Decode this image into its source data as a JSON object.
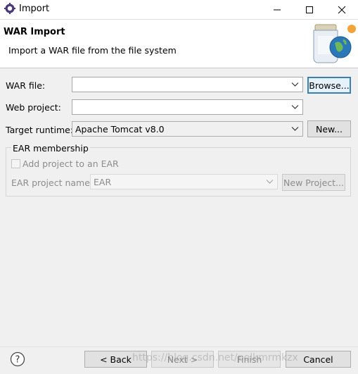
{
  "window": {
    "title": "Import",
    "icon": "eclipse-gear-icon",
    "controls": [
      "minimize",
      "maximize",
      "close"
    ]
  },
  "banner": {
    "title": "WAR Import",
    "description": "Import a WAR file from the file system",
    "image": "war-jar-globe-icon"
  },
  "form": {
    "war_file": {
      "label": "WAR file:",
      "value": "",
      "browse_label": "Browse..."
    },
    "web_project": {
      "label": "Web project:",
      "value": ""
    },
    "target_runtime": {
      "label": "Target runtime:",
      "value": "Apache Tomcat v8.0",
      "new_label": "New..."
    }
  },
  "ear": {
    "group_title": "EAR membership",
    "checkbox_label": "Add project to an EAR",
    "checked": false,
    "project_label": "EAR project name:",
    "project_value": "EAR",
    "new_project_label": "New Project..."
  },
  "footer": {
    "help_icon": "help-question-icon",
    "back_label": "< Back",
    "next_label": "Next >",
    "finish_label": "Finish",
    "cancel_label": "Cancel"
  },
  "watermark": "https://blog.csdn.net/polkmrmkzx"
}
